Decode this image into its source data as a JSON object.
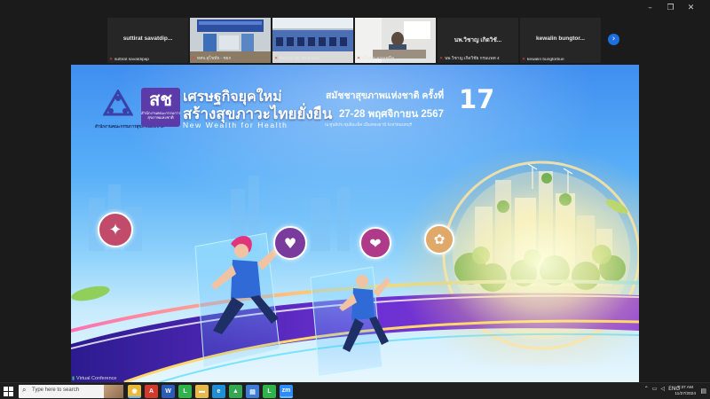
{
  "window_controls": {
    "minimize": "–",
    "restore": "❐",
    "close": "✕"
  },
  "participants": [
    {
      "display_name": "suttirat savatdip...",
      "caption": "suttirat savatdipap",
      "type": "name"
    },
    {
      "display_name": "",
      "caption": "ทศจ.สุโขทัย - ชยก",
      "type": "video"
    },
    {
      "display_name": "",
      "caption": "ห้องประชุม รพ.สูงเม่น",
      "type": "video"
    },
    {
      "display_name": "",
      "caption": "สุโขทัย ลานเหนือ",
      "type": "video"
    },
    {
      "display_name": "นพ.วิชาญ เกิดวิชั...",
      "caption": "นพ.วิชาญ เกิดวิชัย กรมแพท 4",
      "type": "name"
    },
    {
      "display_name": "kewalin bungtor...",
      "caption": "kewalin bungtorbue",
      "type": "name"
    }
  ],
  "strip_next_icon": "›",
  "presentation": {
    "org_label": "สำนักงานคณะกรรมการสุขภาพแห่งชาติ",
    "logo_glyph": "สช",
    "logo_text_line1": "สำนักงานคณะกรรมการ",
    "logo_text_line2": "สุขภาพแห่งชาติ",
    "title_line1": "เศรษฐกิจยุคใหม่",
    "title_line2": "สร้างสุขภาวะไทยยั่งยืน",
    "title_en": "New Wealth for Health",
    "event_name": "สมัชชาสุขภาพแห่งชาติ ครั้งที่",
    "event_number": "17",
    "event_dates": "27-28 พฤศจิกายน 2567",
    "event_venue": "ณ ศูนย์ประชุมอิมแพ็ค เมืองทองธานี จังหวัดนนทบุรี"
  },
  "icons": {
    "bubble1": "✦",
    "bubble2": "♥",
    "bubble3": "❤",
    "bubble4": "✿"
  },
  "virtual_caption": "Virtual Conference",
  "taskbar": {
    "search_placeholder": "Type here to search",
    "apps": [
      {
        "name": "chrome-icon",
        "glyph": "◉",
        "color": "#e8b93a",
        "active": true
      },
      {
        "name": "pdf-icon",
        "glyph": "A",
        "color": "#d23b2c",
        "active": false
      },
      {
        "name": "word-icon",
        "glyph": "W",
        "color": "#2b5cb8",
        "active": false
      },
      {
        "name": "line-icon",
        "glyph": "L",
        "color": "#2fb34a",
        "active": false
      },
      {
        "name": "folder-icon",
        "glyph": "▬",
        "color": "#e6b94a",
        "active": false
      },
      {
        "name": "edge-icon",
        "glyph": "e",
        "color": "#1f8fd6",
        "active": false
      },
      {
        "name": "drive-icon",
        "glyph": "▲",
        "color": "#34a853",
        "active": false
      },
      {
        "name": "photos-icon",
        "glyph": "▤",
        "color": "#3d7dd8",
        "active": false
      },
      {
        "name": "line-icon-2",
        "glyph": "L",
        "color": "#2fb34a",
        "active": false
      },
      {
        "name": "zoom-icon",
        "glyph": "zm",
        "color": "#2d8cff",
        "active": true
      }
    ],
    "tray_language": "ENG",
    "time": "8:37 AM",
    "date": "11/27/2024"
  }
}
